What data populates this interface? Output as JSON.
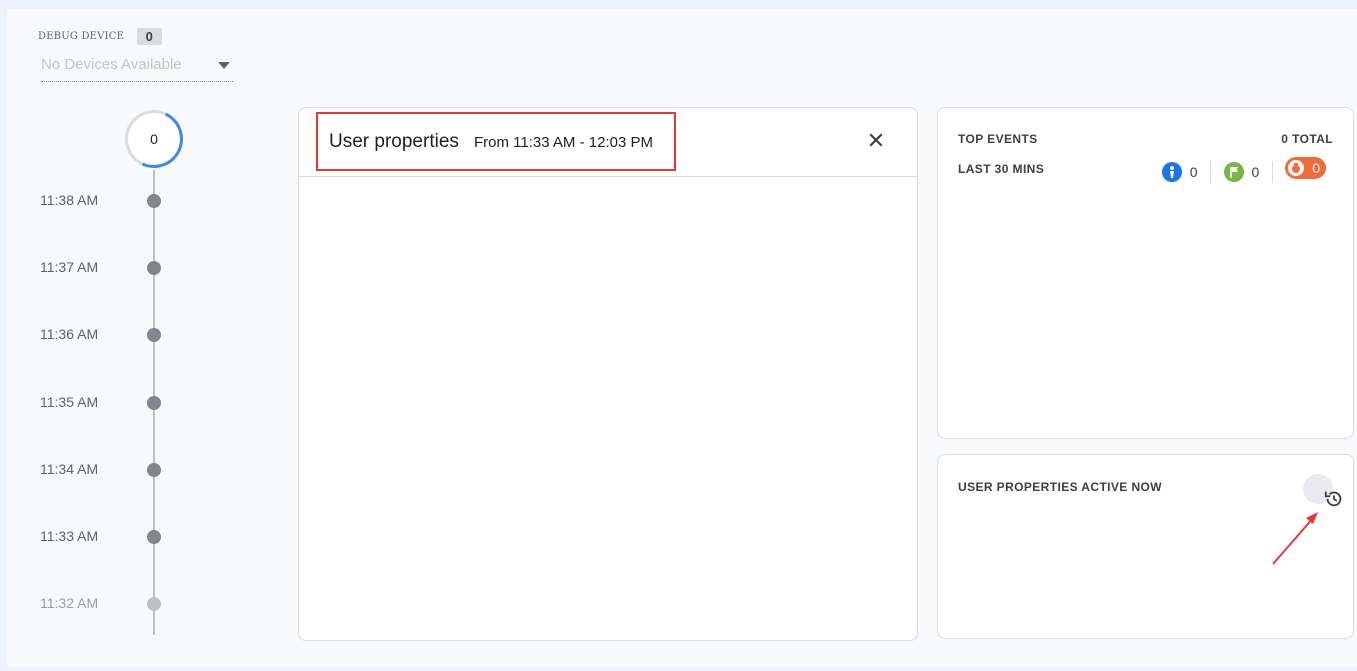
{
  "debug_device": {
    "label": "DEBUG DEVICE",
    "count": "0",
    "select_value": "No Devices Available"
  },
  "timeline": {
    "counter": "0",
    "times": [
      "11:38 AM",
      "11:37 AM",
      "11:36 AM",
      "11:35 AM",
      "11:34 AM",
      "11:33 AM",
      "11:32 AM"
    ]
  },
  "main_panel": {
    "title": "User properties",
    "range": "From 11:33 AM - 12:03 PM",
    "close_symbol": "✕"
  },
  "top_events": {
    "heading": "TOP EVENTS",
    "total": "0 TOTAL",
    "period": "LAST 30 MINS",
    "badges": [
      {
        "icon": "blue-event-icon",
        "count": "0",
        "color": "#1a73e8"
      },
      {
        "icon": "green-flag-icon",
        "count": "0",
        "color": "#7cb342"
      },
      {
        "icon": "orange-error-icon",
        "count": "0",
        "color": "#f26b3a"
      }
    ]
  },
  "user_properties_active": {
    "heading": "USER PROPERTIES ACTIVE NOW",
    "history_icon": "history-icon"
  },
  "colors": {
    "accent_blue": "#4285f4",
    "highlight_red": "#e53935"
  }
}
